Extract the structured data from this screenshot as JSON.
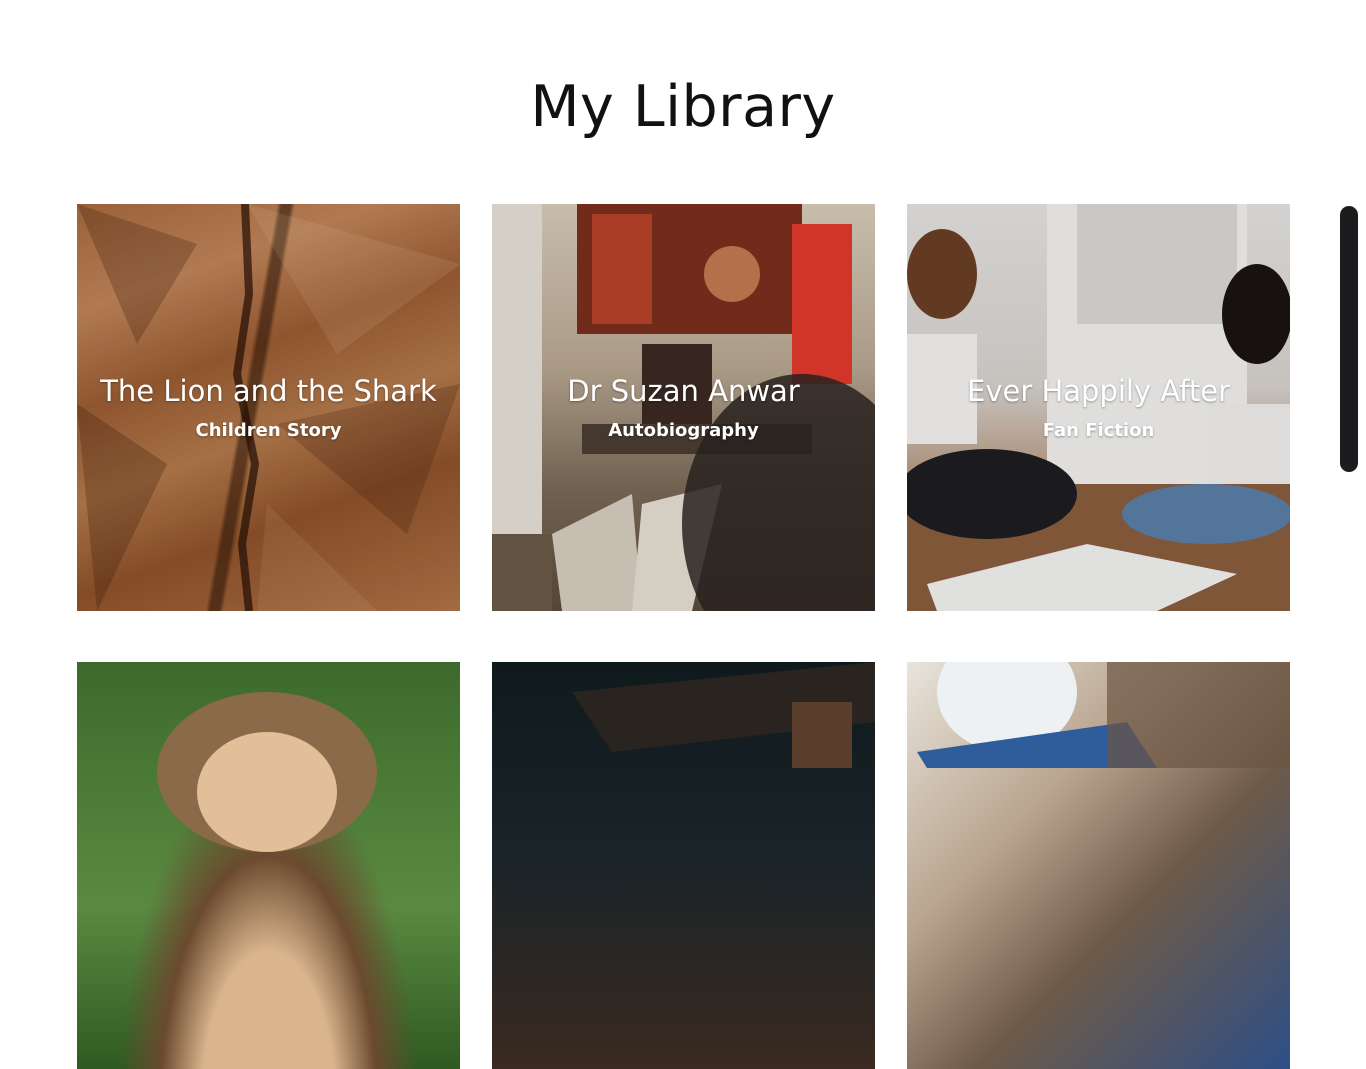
{
  "page": {
    "title": "My Library"
  },
  "cards": [
    {
      "title": "The Lion and the Shark",
      "genre": "Children Story"
    },
    {
      "title": "Dr Suzan Anwar",
      "genre": "Autobiography"
    },
    {
      "title": "Ever Happily After",
      "genre": "Fan Fiction"
    }
  ]
}
